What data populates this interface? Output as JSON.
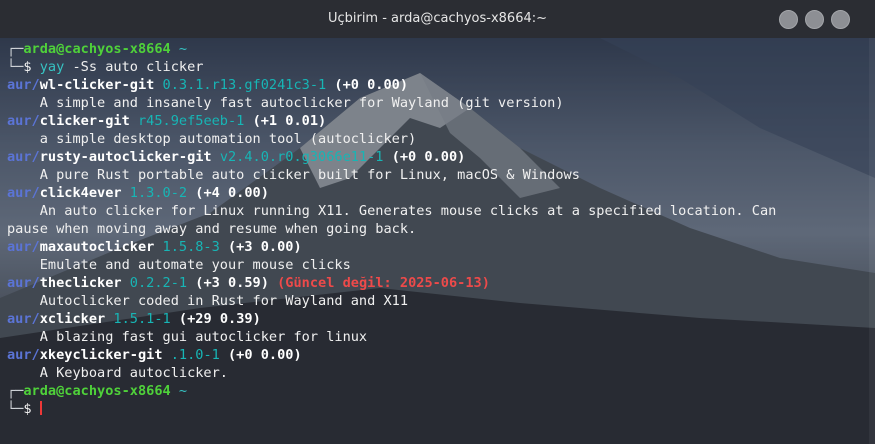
{
  "window": {
    "title": "Uçbirim - arda@cachyos-x8664:~"
  },
  "prompt1": {
    "user_host": "arda@cachyos-x8664",
    "tilde": "~",
    "dollar": "$",
    "cmd_name": "yay",
    "cmd_args": "-Ss auto clicker"
  },
  "results": [
    {
      "repo": "aur/",
      "name": "wl-clicker-git",
      "version": "0.3.1.r13.gf0241c3-1",
      "votes": "(+0 0.00)",
      "desc": "A simple and insanely fast autoclicker for Wayland (git version)"
    },
    {
      "repo": "aur/",
      "name": "clicker-git",
      "version": "r45.9ef5eeb-1",
      "votes": "(+1 0.01)",
      "desc": "a simple desktop automation tool (autoclicker)"
    },
    {
      "repo": "aur/",
      "name": "rusty-autoclicker-git",
      "version": "v2.4.0.r0.g3066e11-1",
      "votes": "(+0 0.00)",
      "desc": "A pure Rust portable auto clicker built for Linux, macOS & Windows"
    },
    {
      "repo": "aur/",
      "name": "click4ever",
      "version": "1.3.0-2",
      "votes": "(+4 0.00)",
      "desc": "An auto clicker for Linux running X11. Generates mouse clicks at a specified location. Can",
      "desc2": "pause when moving away and resume when going back."
    },
    {
      "repo": "aur/",
      "name": "maxautoclicker",
      "version": "1.5.8-3",
      "votes": "(+3 0.00)",
      "desc": "Emulate and automate your mouse clicks"
    },
    {
      "repo": "aur/",
      "name": "theclicker",
      "version": "0.2.2-1",
      "votes": "(+3 0.59)",
      "outdated": "(Güncel değil: 2025-06-13)",
      "desc": "Autoclicker coded in Rust for Wayland and X11"
    },
    {
      "repo": "aur/",
      "name": "xclicker",
      "version": "1.5.1-1",
      "votes": "(+29 0.39)",
      "desc": "A blazing fast gui autoclicker for linux"
    },
    {
      "repo": "aur/",
      "name": "xkeyclicker-git",
      "version": ".1.0-1",
      "votes": "(+0 0.00)",
      "desc": "A Keyboard autoclicker."
    }
  ],
  "prompt2": {
    "user_host": "arda@cachyos-x8664",
    "tilde": "~",
    "dollar": "$"
  },
  "colors": {
    "prompt_green": "#4fd13a",
    "repo_blue": "#5b74d6",
    "version_teal": "#17b5b5",
    "outdated_red": "#ee4a4a",
    "cursor_red": "#ee3838"
  }
}
